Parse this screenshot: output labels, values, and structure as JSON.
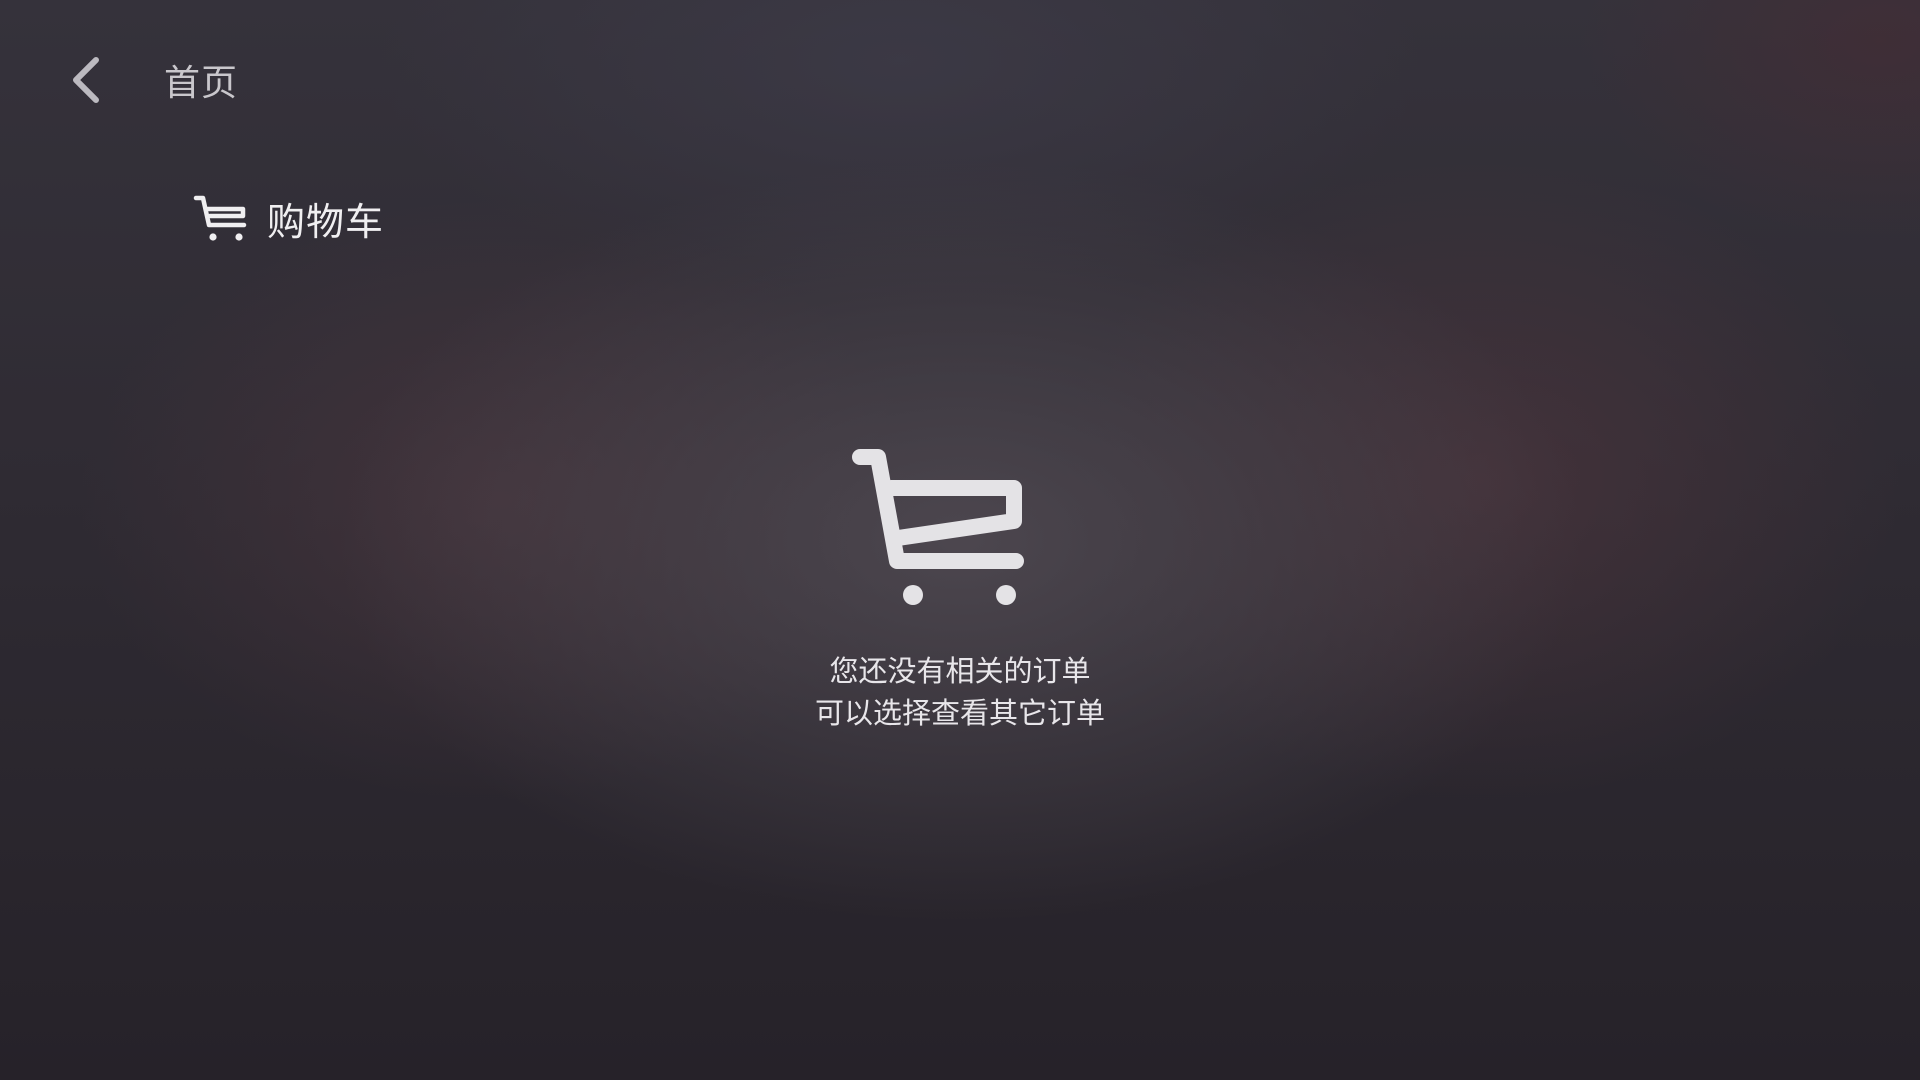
{
  "header": {
    "back_icon": "chevron-left-icon",
    "title": "首页"
  },
  "section": {
    "icon": "shopping-cart-icon",
    "title": "购物车"
  },
  "empty_state": {
    "icon": "shopping-cart-icon",
    "line1": "您还没有相关的订单",
    "line2": "可以选择查看其它订单"
  },
  "colors": {
    "background": "#2c2831",
    "text_primary": "#f0eff1",
    "text_secondary": "#c9c7cc",
    "icon": "#e4e3e6"
  }
}
